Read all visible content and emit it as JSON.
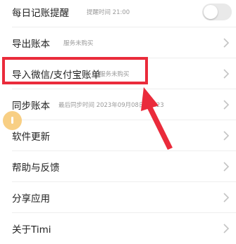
{
  "settings": {
    "items": [
      {
        "title": "每日记账提醒",
        "sub": "提醒时间 21:00"
      },
      {
        "title": "导出账本",
        "sub": "服务未购买"
      },
      {
        "title": "导入微信/支付宝账单",
        "sub": "服务未购买"
      },
      {
        "title": "同步账本",
        "sub": "最后同步时间 2023年09月08日 21:23"
      },
      {
        "title": "软件更新",
        "sub": ""
      },
      {
        "title": "帮助与反馈",
        "sub": ""
      },
      {
        "title": "分享应用",
        "sub": ""
      },
      {
        "title": "关于Timi",
        "sub": ""
      }
    ],
    "reminder_toggle_on": false
  },
  "annotation": {
    "box_color": "#ea2b3b",
    "arrow_color": "#ea2b3b",
    "highlighted_item": "导入微信/支付宝账单"
  },
  "icons": {
    "chevron": "chevron-right-icon",
    "floating": "floating-assistant-icon"
  }
}
